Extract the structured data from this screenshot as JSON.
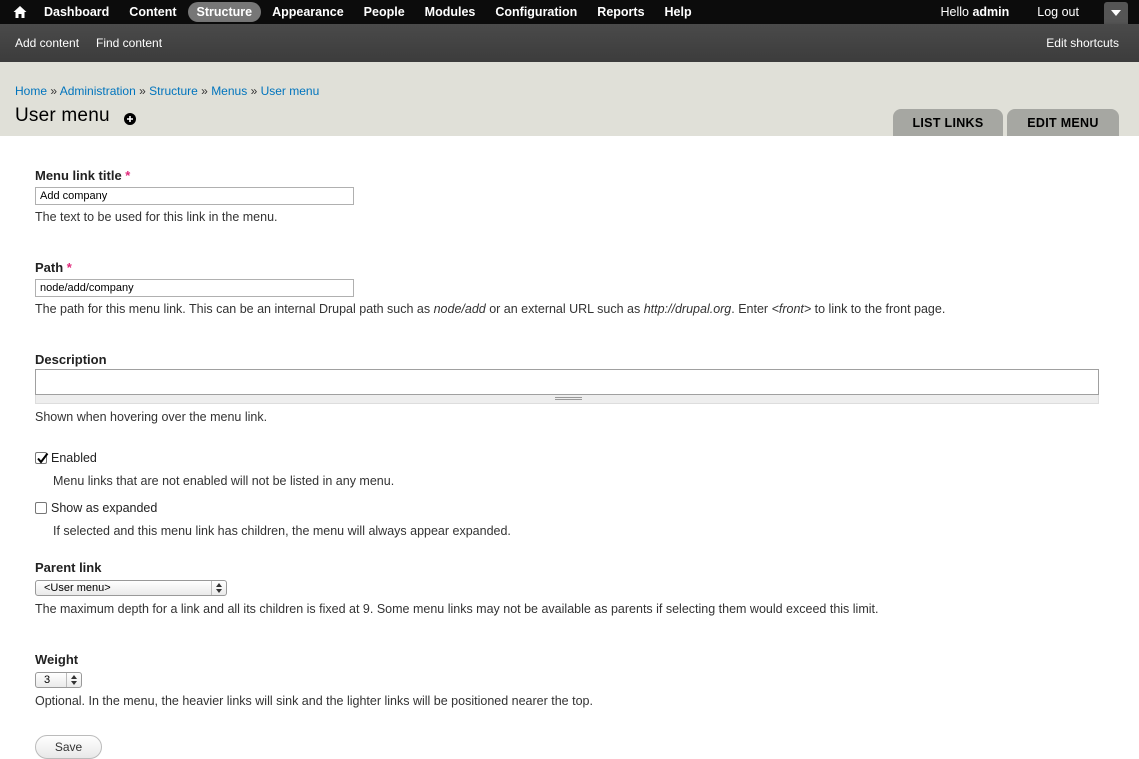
{
  "toolbar": {
    "items": [
      {
        "label": "Dashboard",
        "active": false
      },
      {
        "label": "Content",
        "active": false
      },
      {
        "label": "Structure",
        "active": true
      },
      {
        "label": "Appearance",
        "active": false
      },
      {
        "label": "People",
        "active": false
      },
      {
        "label": "Modules",
        "active": false
      },
      {
        "label": "Configuration",
        "active": false
      },
      {
        "label": "Reports",
        "active": false
      },
      {
        "label": "Help",
        "active": false
      }
    ],
    "hello_prefix": "Hello ",
    "username": "admin",
    "logout": "Log out"
  },
  "shortcuts": {
    "add_content": "Add content",
    "find_content": "Find content",
    "edit_shortcuts": "Edit shortcuts"
  },
  "breadcrumb": [
    "Home",
    "Administration",
    "Structure",
    "Menus",
    "User menu"
  ],
  "breadcrumb_sep": "»",
  "page_title": "User menu",
  "tabs": {
    "list_links": "LIST LINKS",
    "edit_menu": "EDIT MENU"
  },
  "form": {
    "title_label": "Menu link title",
    "required_mark": "*",
    "title_value": "Add company",
    "title_desc": "The text to be used for this link in the menu.",
    "path_label": "Path",
    "path_value": "node/add/company",
    "path_desc_1": "The path for this menu link. This can be an internal Drupal path such as ",
    "path_desc_em1": "node/add",
    "path_desc_2": " or an external URL such as ",
    "path_desc_em2": "http://drupal.org",
    "path_desc_3": ". Enter ",
    "path_desc_em3": "<front>",
    "path_desc_4": " to link to the front page.",
    "description_label": "Description",
    "description_value": "",
    "description_desc": "Shown when hovering over the menu link.",
    "enabled_label": "Enabled",
    "enabled_checked": true,
    "enabled_desc": "Menu links that are not enabled will not be listed in any menu.",
    "expanded_label": "Show as expanded",
    "expanded_checked": false,
    "expanded_desc": "If selected and this menu link has children, the menu will always appear expanded.",
    "parent_label": "Parent link",
    "parent_value": "<User menu>",
    "parent_desc": "The maximum depth for a link and all its children is fixed at 9. Some menu links may not be available as parents if selecting them would exceed this limit.",
    "weight_label": "Weight",
    "weight_value": "3",
    "weight_desc": "Optional. In the menu, the heavier links will sink and the lighter links will be positioned nearer the top.",
    "save_label": "Save"
  },
  "colors": {
    "link": "#0074bd",
    "required": "#e0287a",
    "toolbar_bg": "#0c0c0c",
    "header_bg": "#e0e0d8",
    "tab_bg": "#a6a7a2"
  }
}
